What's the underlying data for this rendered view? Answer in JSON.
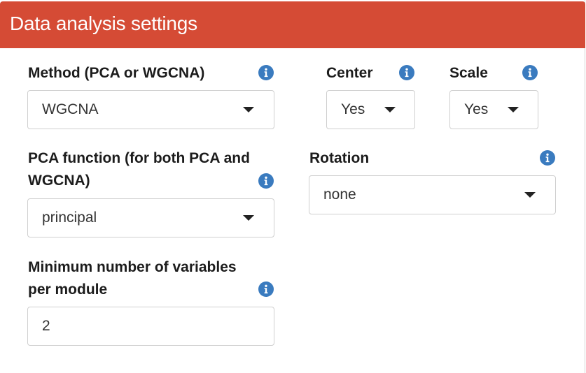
{
  "panel": {
    "title": "Data analysis settings",
    "header_color": "#d54b35"
  },
  "fields": {
    "method": {
      "label": "Method (PCA or WGCNA)",
      "value": "WGCNA",
      "icon": "info-icon"
    },
    "center": {
      "label": "Center",
      "value": "Yes",
      "icon": "info-icon"
    },
    "scale": {
      "label": "Scale",
      "value": "Yes",
      "icon": "info-icon"
    },
    "pca_function": {
      "label_line1": "PCA function (for both PCA and",
      "label_line2": "WGCNA)",
      "value": "principal",
      "icon": "info-icon"
    },
    "rotation": {
      "label": "Rotation",
      "value": "none",
      "icon": "info-icon"
    },
    "min_vars": {
      "label_line1": "Minimum number of variables",
      "label_line2": "per module",
      "value": "2",
      "icon": "info-icon"
    }
  },
  "colors": {
    "info_icon": "#3a7bbf",
    "border": "#cfcfcf"
  }
}
